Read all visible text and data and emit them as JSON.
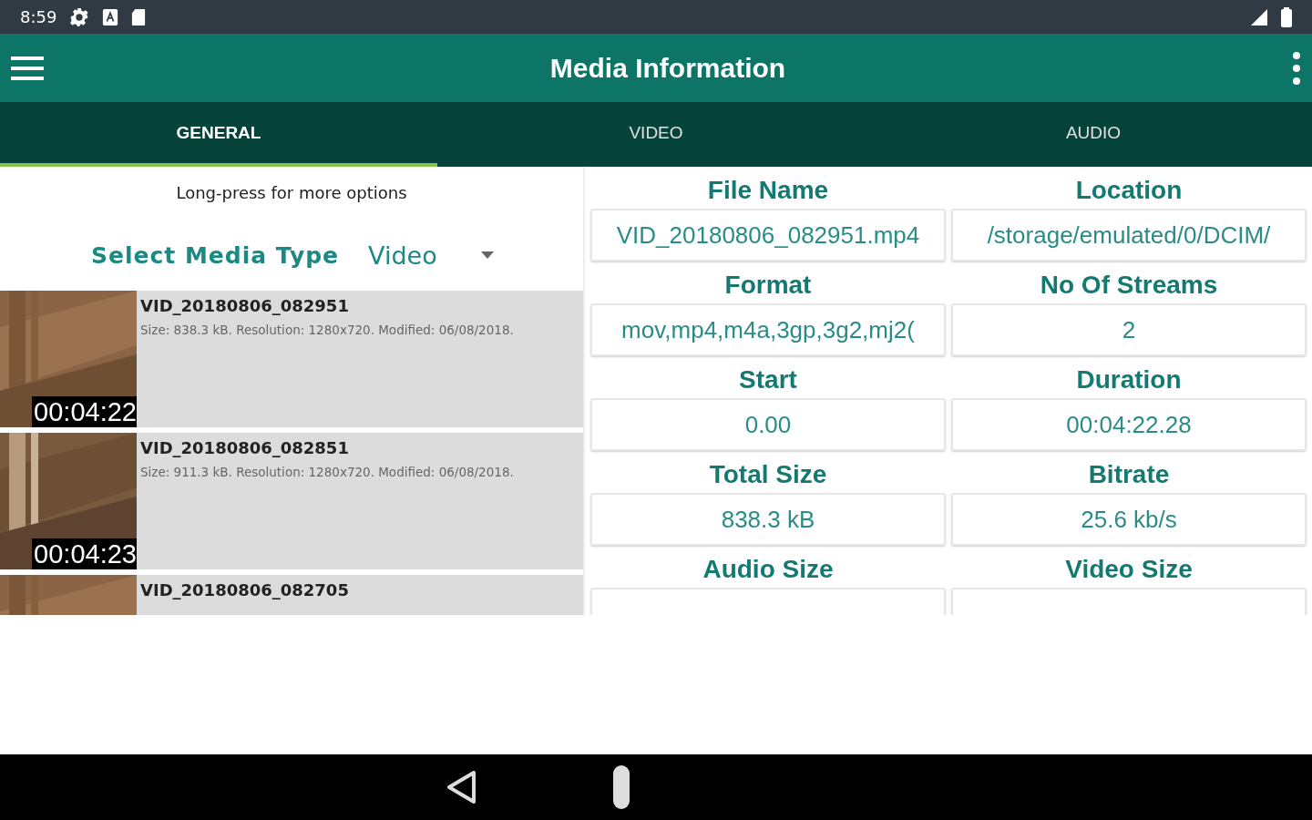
{
  "status_bar": {
    "time": "8:59"
  },
  "app_bar": {
    "title": "Media Information"
  },
  "tabs": [
    {
      "label": "GENERAL",
      "selected": true
    },
    {
      "label": "VIDEO",
      "selected": false
    },
    {
      "label": "AUDIO",
      "selected": false
    }
  ],
  "hint": "Long-press for more options",
  "media_type": {
    "label": "Select Media Type",
    "value": "Video"
  },
  "files": [
    {
      "name": "VID_20180806_082951",
      "details": "Size: 838.3 kB. Resolution: 1280x720. Modified: 06/08/2018.",
      "duration": "00:04:22"
    },
    {
      "name": "VID_20180806_082851",
      "details": "Size: 911.3 kB. Resolution: 1280x720. Modified: 06/08/2018.",
      "duration": "00:04:23"
    },
    {
      "name": "VID_20180806_082705"
    }
  ],
  "info_fields": [
    {
      "label": "File Name",
      "value": "VID_20180806_082951.mp4"
    },
    {
      "label": "Location",
      "value": "/storage/emulated/0/DCIM/"
    },
    {
      "label": "Format",
      "value": "mov,mp4,m4a,3gp,3g2,mj2("
    },
    {
      "label": "No Of Streams",
      "value": "2"
    },
    {
      "label": "Start",
      "value": "0.00"
    },
    {
      "label": "Duration",
      "value": "00:04:22.28"
    },
    {
      "label": "Total Size",
      "value": "838.3 kB"
    },
    {
      "label": "Bitrate",
      "value": "25.6 kb/s"
    },
    {
      "label": "Audio Size"
    },
    {
      "label": "Video Size"
    }
  ]
}
